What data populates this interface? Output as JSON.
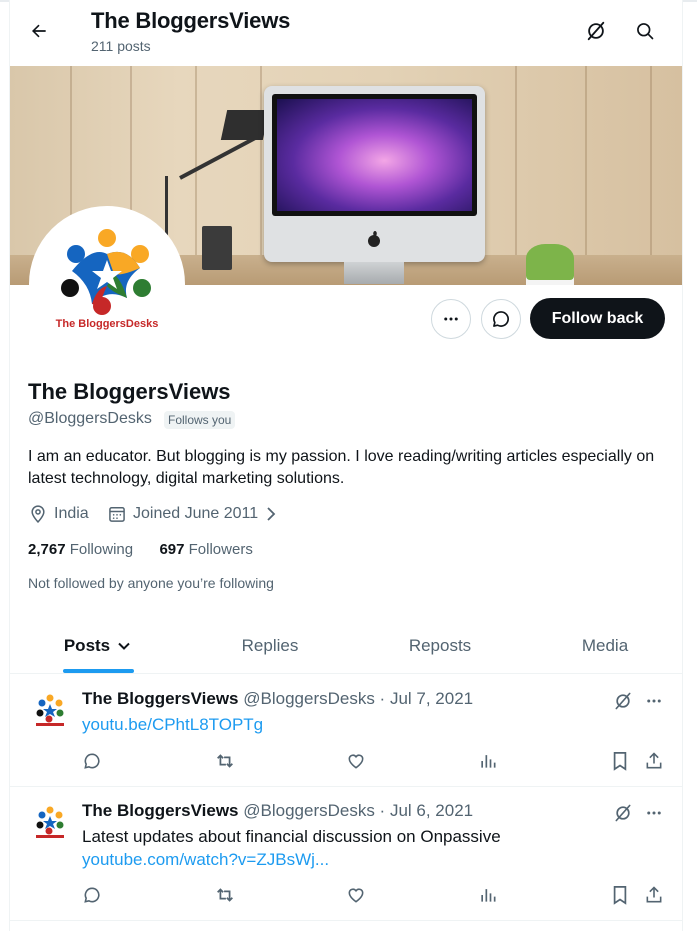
{
  "header": {
    "title": "The BloggersViews",
    "post_count": "211 posts",
    "back_icon": "arrow-left-icon",
    "grok_icon": "grok-icon",
    "search_icon": "search-icon"
  },
  "profile": {
    "avatar_text": "The BloggersDesks",
    "name": "The BloggersViews",
    "handle": "@BloggersDesks",
    "follows_you": "Follows you",
    "bio": "I am an educator. But blogging is my passion. I love reading/writing articles especially on latest technology, digital marketing solutions.",
    "location": "India",
    "joined": "Joined June 2011",
    "following_count": "2,767",
    "following_label": "Following",
    "followers_count": "697",
    "followers_label": "Followers",
    "not_followed": "Not followed by anyone you’re following",
    "follow_back_label": "Follow back"
  },
  "tabs": [
    {
      "label": "Posts",
      "active": true
    },
    {
      "label": "Replies",
      "active": false
    },
    {
      "label": "Reposts",
      "active": false
    },
    {
      "label": "Media",
      "active": false
    }
  ],
  "posts": [
    {
      "name": "The BloggersViews",
      "handle_date": "@BloggersDesks · Jul 7, 2021",
      "text": "",
      "link": "youtu.be/CPhtL8TOPTg"
    },
    {
      "name": "The BloggersViews",
      "handle_date": "@BloggersDesks · Jul 6, 2021",
      "text": "Latest updates about financial discussion on Onpassive",
      "link": "youtube.com/watch?v=ZJBsWj..."
    }
  ],
  "colors": {
    "accent": "#1d9bf0",
    "text": "#0f1419",
    "muted": "#536471",
    "follow_bg": "#0f1419"
  }
}
